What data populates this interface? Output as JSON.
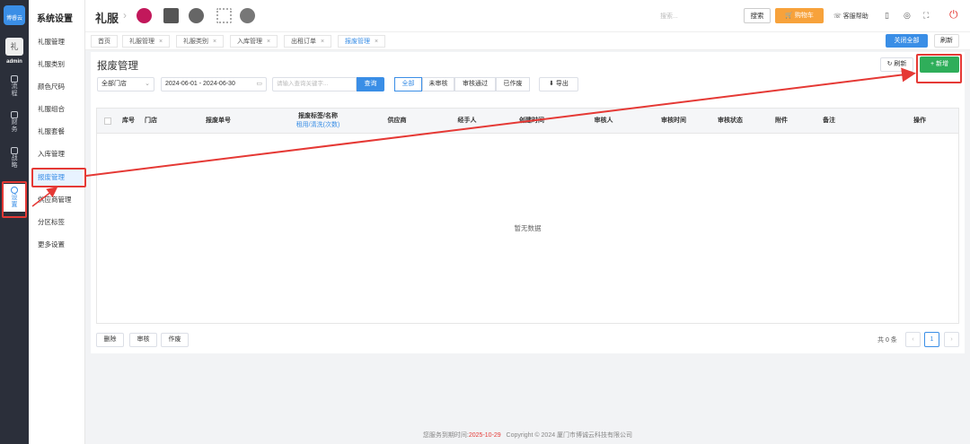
{
  "rail": {
    "logo_text": "博睿云",
    "avatar_text": "礼",
    "user": "admin",
    "items": [
      {
        "label": "流\n程"
      },
      {
        "label": "财\n务"
      },
      {
        "label": "战\n略"
      },
      {
        "label": "设\n置"
      }
    ]
  },
  "submenu": {
    "title": "系统设置",
    "items": [
      "礼服管理",
      "礼服类别",
      "颜色尺码",
      "礼服组合",
      "礼服套餐",
      "入库管理",
      "报废管理",
      "供应商管理",
      "分区标签",
      "更多设置"
    ],
    "active_index": 6
  },
  "topbar": {
    "brand": "礼服",
    "search_placeholder": "搜索...",
    "search_button": "搜索",
    "cart_button": "购物车",
    "help": "客服帮助"
  },
  "tabs": {
    "items": [
      "首页",
      "礼服管理",
      "礼服类别",
      "入库管理",
      "出租订单",
      "报废管理"
    ],
    "active_index": 5,
    "close_all": "关闭全部",
    "refresh": "刷新"
  },
  "page": {
    "title": "报废管理",
    "store_select": "全部门店",
    "date_range": "2024-06-01 - 2024-06-30",
    "keyword_placeholder": "请输入查询关键字...",
    "query_button": "查询",
    "filters": [
      "全部",
      "未审核",
      "审核通过",
      "已作废"
    ],
    "active_filter": 0,
    "export_button": "导出",
    "refresh_button": "刷新",
    "add_button": "新增"
  },
  "table": {
    "columns": [
      {
        "label": "库号"
      },
      {
        "label": "门店"
      },
      {
        "label": "报废单号"
      },
      {
        "label": "报废标签/名称",
        "sub": "租用/清洗(次数)"
      },
      {
        "label": "供应商"
      },
      {
        "label": "经手人"
      },
      {
        "label": "创建时间"
      },
      {
        "label": "审核人"
      },
      {
        "label": "审核时间"
      },
      {
        "label": "审核状态"
      },
      {
        "label": "附件"
      },
      {
        "label": "备注"
      },
      {
        "label": "操作"
      }
    ],
    "empty_text": "暂无数据"
  },
  "bulk": {
    "delete": "删除",
    "review": "审核",
    "void": "作废"
  },
  "pagination": {
    "total_text": "共 0 条",
    "current_page": "1",
    "prev": "‹",
    "next": "›"
  },
  "footer": {
    "expire_label": "您服务到期时间:",
    "expire_date": "2025-10-29",
    "copyright": "Copyright © 2024 厦门市博诚云科技有限公司"
  },
  "colors": {
    "primary": "#3a8ee6",
    "add_green": "#2fae5a",
    "cart_orange": "#f7a23b",
    "annotation_red": "#e53935"
  }
}
